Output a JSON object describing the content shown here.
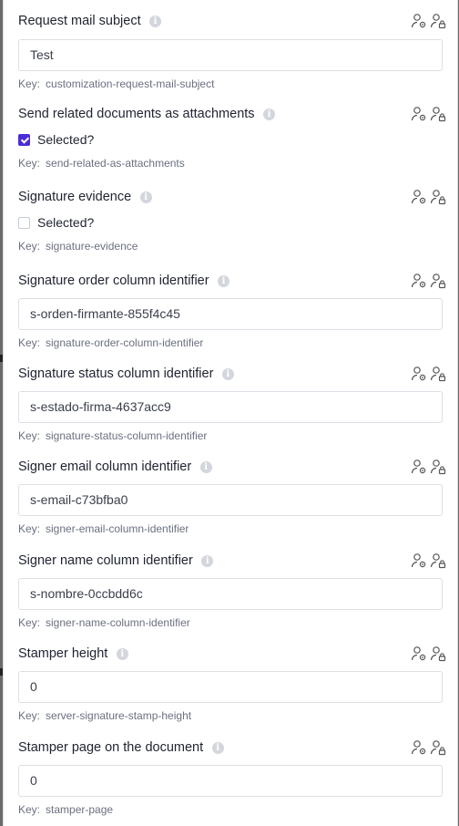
{
  "fields": [
    {
      "label": "Request mail subject",
      "type": "text",
      "value": "Test",
      "key_label": "Key:",
      "key": "customization-request-mail-subject"
    },
    {
      "label": "Send related documents as attachments",
      "type": "checkbox",
      "checked": true,
      "checkbox_label": "Selected?",
      "key_label": "Key:",
      "key": "send-related-as-attachments"
    },
    {
      "label": "Signature evidence",
      "type": "checkbox",
      "checked": false,
      "checkbox_label": "Selected?",
      "key_label": "Key:",
      "key": "signature-evidence"
    },
    {
      "label": "Signature order column identifier",
      "type": "text",
      "value": "s-orden-firmante-855f4c45",
      "key_label": "Key:",
      "key": "signature-order-column-identifier"
    },
    {
      "label": "Signature status column identifier",
      "type": "text",
      "value": "s-estado-firma-4637acc9",
      "key_label": "Key:",
      "key": "signature-status-column-identifier"
    },
    {
      "label": "Signer email column identifier",
      "type": "text",
      "value": "s-email-c73bfba0",
      "key_label": "Key:",
      "key": "signer-email-column-identifier"
    },
    {
      "label": "Signer name column identifier",
      "type": "text",
      "value": "s-nombre-0ccbdd6c",
      "key_label": "Key:",
      "key": "signer-name-column-identifier"
    },
    {
      "label": "Stamper height",
      "type": "text",
      "value": "0",
      "key_label": "Key:",
      "key": "server-signature-stamp-height"
    },
    {
      "label": "Stamper page on the document",
      "type": "text",
      "value": "0",
      "key_label": "Key:",
      "key": "stamper-page"
    }
  ],
  "icons": {
    "info": "info-icon",
    "user_settings": "user-settings-icon",
    "user_lock": "user-lock-icon"
  },
  "colors": {
    "accent": "#4b2dd8",
    "text": "#1f2330",
    "muted": "#6b7080",
    "border": "#dcdfe5"
  }
}
